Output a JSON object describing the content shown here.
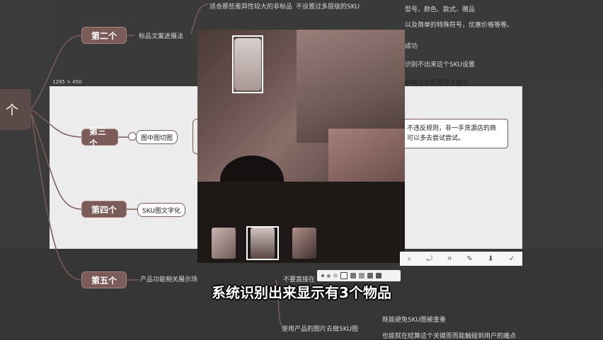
{
  "mindmap": {
    "root_char": "个",
    "nodes": [
      "第二个",
      "第三个",
      "第四个",
      "第五个"
    ],
    "branches": {
      "top1": "适合那些差异性较大的非标品",
      "top2": "不设置过多层级的SKU",
      "top3": "型号、颜色、款式、赠品",
      "top4": "以及简单的特殊符号，优惠价格等等。",
      "second_label": "标品文案进展法",
      "side1": "成功",
      "side2": "识别不出来这个SKU设置",
      "side3": "价格过高反而得不偿失",
      "cut_label": "图中图切图",
      "callout": "不违反规则，非一手货源店的商可以多去尝试尝试。",
      "sku_label": "SKU图文字化",
      "fifth_label": "产品功能相关展示场",
      "bottom1": "不要直接在",
      "bottom2": "使用产品的图片去做SKU图",
      "bottom3": "既能避免SKU图被查重",
      "bottom4": "也能就在结算这个关键而而能触碰到用户的痛点"
    }
  },
  "dim_label": "1295 × 450",
  "subtitle": "系统识别出来显示有3个物品",
  "toolbar_colors": [
    "#777777",
    "#999999",
    "#666666",
    "#555555"
  ],
  "right_tools": [
    "⌕",
    "⤾",
    "⌗",
    "✎",
    "⬇",
    "✓"
  ]
}
